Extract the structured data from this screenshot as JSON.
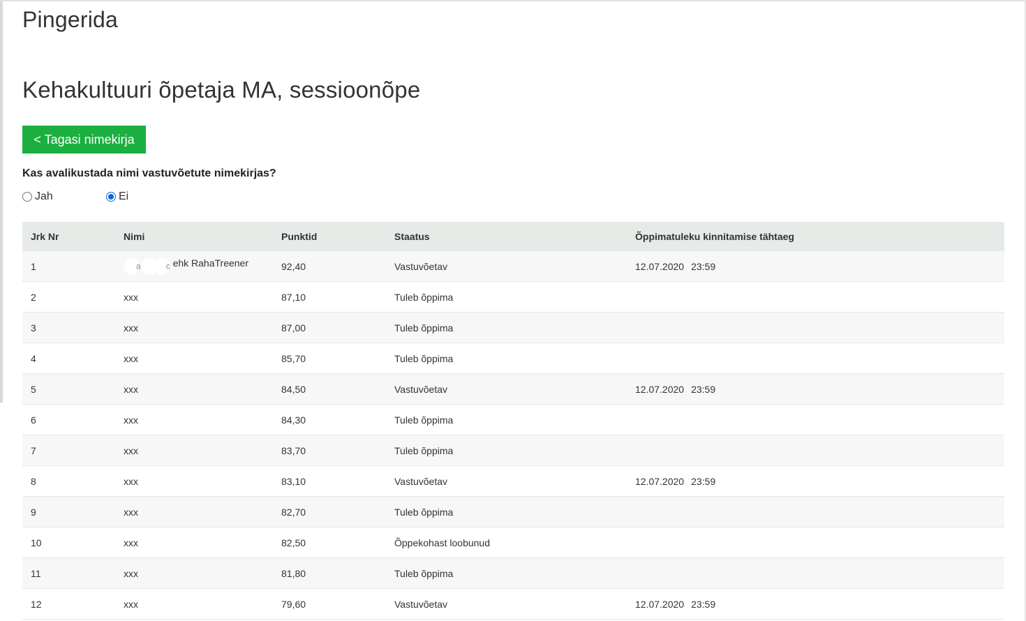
{
  "page_title": "Pingerida",
  "program_title": "Kehakultuuri õpetaja MA, sessioonõpe",
  "back_button": "< Tagasi nimekirja",
  "publish_question": "Kas avalikustada nimi vastuvõetute nimekirjas?",
  "publish_options": [
    {
      "label": "Jah",
      "checked": false
    },
    {
      "label": "Ei",
      "checked": true
    }
  ],
  "table": {
    "headers": [
      "Jrk Nr",
      "Nimi",
      "Punktid",
      "Staatus",
      "Õppimatuleku kinnitamise tähtaeg"
    ],
    "rows": [
      {
        "nr": "1",
        "name_fragment_a": "a",
        "name_fragment_c": "c",
        "name": "ehk RahaTreener",
        "points": "92,40",
        "status": "Vastuvõetav",
        "date": "12.07.2020",
        "time": "23:59"
      },
      {
        "nr": "2",
        "name": "xxx",
        "points": "87,10",
        "status": "Tuleb õppima",
        "date": "",
        "time": ""
      },
      {
        "nr": "3",
        "name": "xxx",
        "points": "87,00",
        "status": "Tuleb õppima",
        "date": "",
        "time": ""
      },
      {
        "nr": "4",
        "name": "xxx",
        "points": "85,70",
        "status": "Tuleb õppima",
        "date": "",
        "time": ""
      },
      {
        "nr": "5",
        "name": "xxx",
        "points": "84,50",
        "status": "Vastuvõetav",
        "date": "12.07.2020",
        "time": "23:59"
      },
      {
        "nr": "6",
        "name": "xxx",
        "points": "84,30",
        "status": "Tuleb õppima",
        "date": "",
        "time": ""
      },
      {
        "nr": "7",
        "name": "xxx",
        "points": "83,70",
        "status": "Tuleb õppima",
        "date": "",
        "time": ""
      },
      {
        "nr": "8",
        "name": "xxx",
        "points": "83,10",
        "status": "Vastuvõetav",
        "date": "12.07.2020",
        "time": "23:59"
      },
      {
        "nr": "9",
        "name": "xxx",
        "points": "82,70",
        "status": "Tuleb õppima",
        "date": "",
        "time": ""
      },
      {
        "nr": "10",
        "name": "xxx",
        "points": "82,50",
        "status": "Õppekohast loobunud",
        "date": "",
        "time": ""
      },
      {
        "nr": "11",
        "name": "xxx",
        "points": "81,80",
        "status": "Tuleb õppima",
        "date": "",
        "time": ""
      },
      {
        "nr": "12",
        "name": "xxx",
        "points": "79,60",
        "status": "Vastuvõetav",
        "date": "12.07.2020",
        "time": "23:59"
      }
    ]
  },
  "colors": {
    "accent_green": "#1aaf3f",
    "header_bg": "#e7ebe8",
    "radio_blue": "#0a66d6"
  }
}
